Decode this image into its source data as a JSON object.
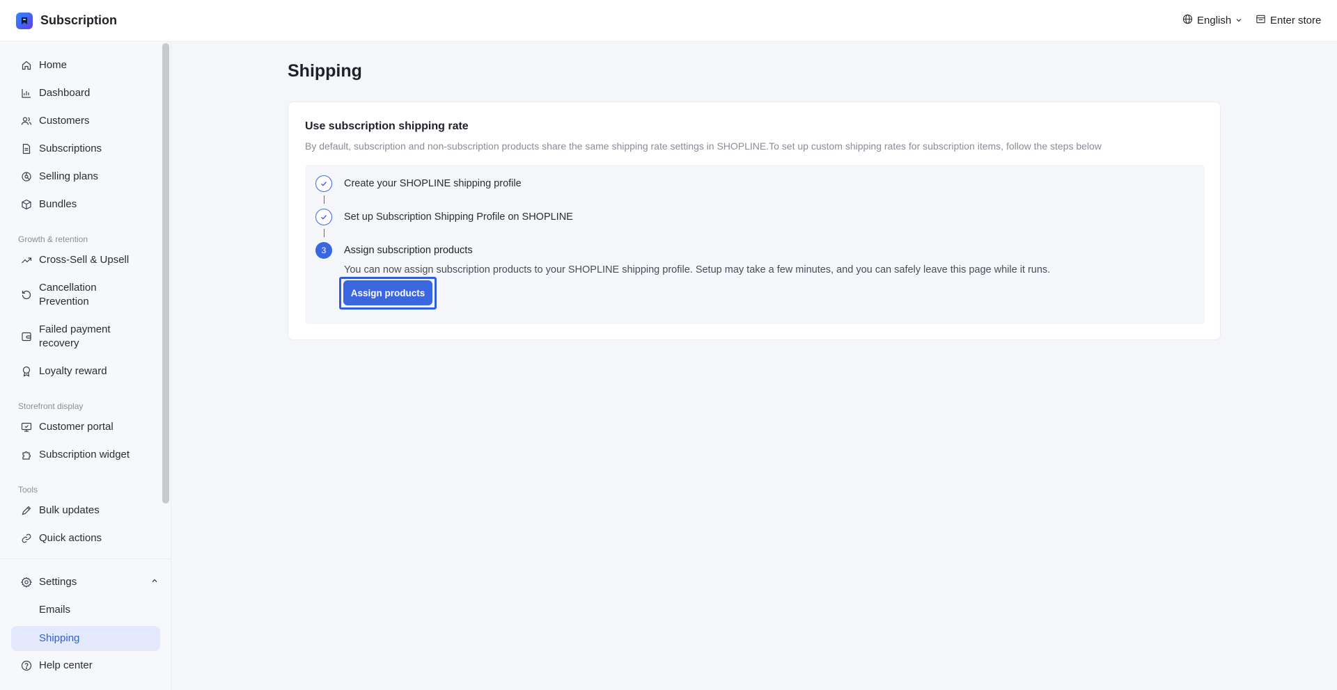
{
  "app": {
    "title": "Subscription"
  },
  "header": {
    "language": "English",
    "enter_store": "Enter store"
  },
  "sidebar": {
    "items": [
      {
        "label": "Home",
        "icon": "home-icon"
      },
      {
        "label": "Dashboard",
        "icon": "chart-icon"
      },
      {
        "label": "Customers",
        "icon": "users-icon"
      },
      {
        "label": "Subscriptions",
        "icon": "document-icon"
      },
      {
        "label": "Selling plans",
        "icon": "plans-icon"
      },
      {
        "label": "Bundles",
        "icon": "box-icon"
      }
    ],
    "growth_label": "Growth & retention",
    "growth_items": [
      {
        "label": "Cross-Sell & Upsell",
        "icon": "trend-up-icon"
      },
      {
        "label": "Cancellation Prevention",
        "icon": "refresh-icon"
      },
      {
        "label": "Failed payment recovery",
        "icon": "wallet-icon"
      },
      {
        "label": "Loyalty reward",
        "icon": "award-icon"
      }
    ],
    "storefront_label": "Storefront display",
    "storefront_items": [
      {
        "label": "Customer portal",
        "icon": "portal-icon"
      },
      {
        "label": "Subscription widget",
        "icon": "puzzle-icon"
      }
    ],
    "tools_label": "Tools",
    "tools_items": [
      {
        "label": "Bulk updates",
        "icon": "pencil-icon"
      },
      {
        "label": "Quick actions",
        "icon": "link-icon"
      }
    ],
    "settings": {
      "label": "Settings",
      "icon": "gear-icon"
    },
    "settings_sub": [
      {
        "label": "Emails"
      },
      {
        "label": "Shipping",
        "active": true
      }
    ],
    "help": {
      "label": "Help center",
      "icon": "help-icon"
    }
  },
  "main": {
    "title": "Shipping",
    "card": {
      "title": "Use subscription shipping rate",
      "description": "By default, subscription and non-subscription products share the same shipping rate settings in SHOPLINE.To set up custom shipping rates for subscription items, follow the steps below",
      "steps": [
        {
          "label": "Create your SHOPLINE shipping profile",
          "status": "done"
        },
        {
          "label": "Set up Subscription Shipping Profile on SHOPLINE",
          "status": "done"
        },
        {
          "label": "Assign subscription products",
          "status": "current",
          "number": "3",
          "description": "You can now assign subscription products to your SHOPLINE shipping profile. Setup may take a few minutes, and you can safely leave this page while it runs."
        }
      ],
      "button_label": "Assign products"
    }
  },
  "colors": {
    "accent": "#3a67e0",
    "active_bg": "#e3e9fb",
    "muted": "#8a8d96"
  }
}
